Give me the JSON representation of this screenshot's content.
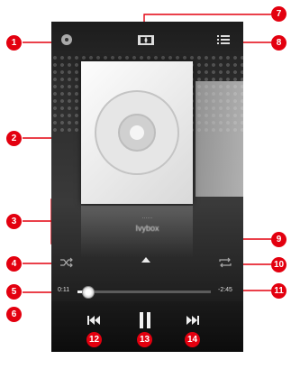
{
  "player": {
    "track_artist": "......",
    "track_title": "Ivybox",
    "elapsed": "0:11",
    "remaining": "-2:45",
    "progress_fraction": 0.08
  },
  "icons": {
    "album": "disc-icon",
    "dolby": "dolby-icon",
    "playlist": "playlist-icon",
    "shuffle": "shuffle-icon",
    "repeat": "repeat-icon",
    "expand": "arrow-up-icon",
    "previous": "previous-icon",
    "pause": "pause-icon",
    "next": "next-icon"
  },
  "callouts": [
    "1",
    "2",
    "3",
    "4",
    "5",
    "6",
    "7",
    "8",
    "9",
    "10",
    "11",
    "12",
    "13",
    "14"
  ],
  "colors": {
    "callout": "#e3000f",
    "screen": "#2b2b2b"
  }
}
